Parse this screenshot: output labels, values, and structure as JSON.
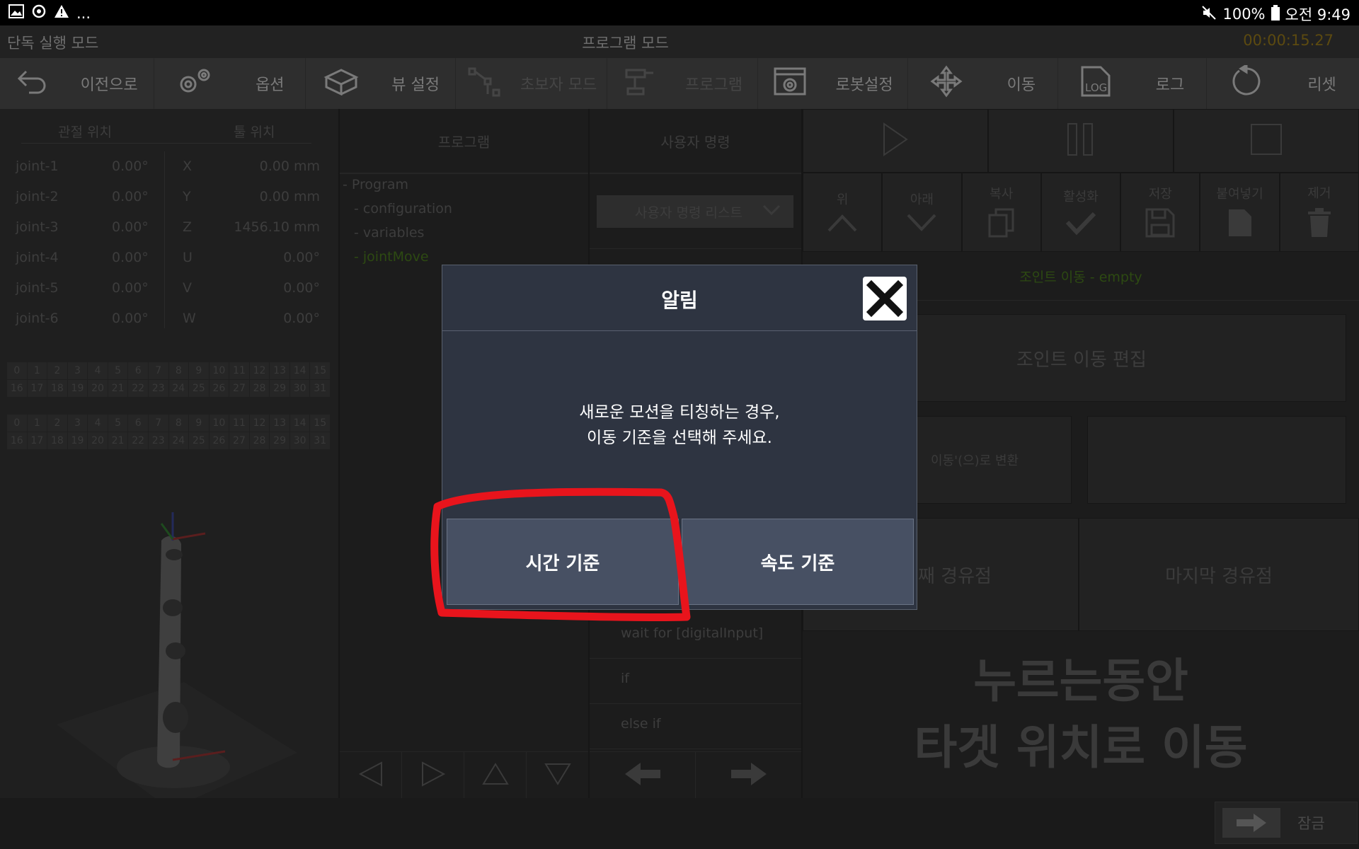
{
  "status_bar": {
    "battery": "100%",
    "time": "오전 9:49",
    "more": "..."
  },
  "mode_bar": {
    "left": "단독 실행 모드",
    "center": "프로그램 모드",
    "timer": "00:00:15.27"
  },
  "toolbar": [
    {
      "label": "이전으로",
      "icon": "back-arrow-icon"
    },
    {
      "label": "옵션",
      "icon": "gears-icon"
    },
    {
      "label": "뷰 설정",
      "icon": "cube-icon"
    },
    {
      "label": "초보자 모드",
      "icon": "robot-arm-icon"
    },
    {
      "label": "프로그램",
      "icon": "robot-icon"
    },
    {
      "label": "로봇설정",
      "icon": "settings-window-icon"
    },
    {
      "label": "이동",
      "icon": "move-arrows-icon"
    },
    {
      "label": "로그",
      "icon": "log-icon"
    },
    {
      "label": "리셋",
      "icon": "reset-icon"
    }
  ],
  "left_panel": {
    "header_joint": "관절 위치",
    "header_tool": "툴 위치",
    "joints": [
      {
        "name": "joint-1",
        "value": "0.00°",
        "axis": "X",
        "tool": "0.00 mm"
      },
      {
        "name": "joint-2",
        "value": "0.00°",
        "axis": "Y",
        "tool": "0.00 mm"
      },
      {
        "name": "joint-3",
        "value": "0.00°",
        "axis": "Z",
        "tool": "1456.10 mm"
      },
      {
        "name": "joint-4",
        "value": "0.00°",
        "axis": "U",
        "tool": "0.00°"
      },
      {
        "name": "joint-5",
        "value": "0.00°",
        "axis": "V",
        "tool": "0.00°"
      },
      {
        "name": "joint-6",
        "value": "0.00°",
        "axis": "W",
        "tool": "0.00°"
      }
    ]
  },
  "program_panel": {
    "title": "프로그램",
    "tree": [
      "- Program",
      "- configuration",
      "- variables",
      "- jointMove"
    ]
  },
  "command_panel": {
    "title": "사용자 명령",
    "dropdown": "사용자 명령 리스트",
    "items": [
      "wait for [digitalInput]",
      "if",
      "else if"
    ]
  },
  "right_panel": {
    "actions": [
      "위",
      "아래",
      "복사",
      "활성화",
      "저장",
      "붙여넣기",
      "제거"
    ],
    "selected_command": "조인트 이동 - empty",
    "edit_button": "조인트 이동 편집",
    "convert_button": "이동'(으)로 변환",
    "waypoint_nth": "째 경유점",
    "waypoint_last": "마지막 경유점",
    "hold_move": [
      "누르는동안",
      "타겟 위치로 이동"
    ]
  },
  "bottom": {
    "lock": "잠금"
  },
  "dialog": {
    "title": "알림",
    "message_line1": "새로운 모션을 티칭하는 경우,",
    "message_line2": "이동 기준을 선택해 주세요.",
    "time_button": "시간 기준",
    "speed_button": "속도 기준"
  },
  "colors": {
    "annotation": "#e8141c",
    "dialog_bg": "#2e3441",
    "dialog_button": "#475063"
  }
}
